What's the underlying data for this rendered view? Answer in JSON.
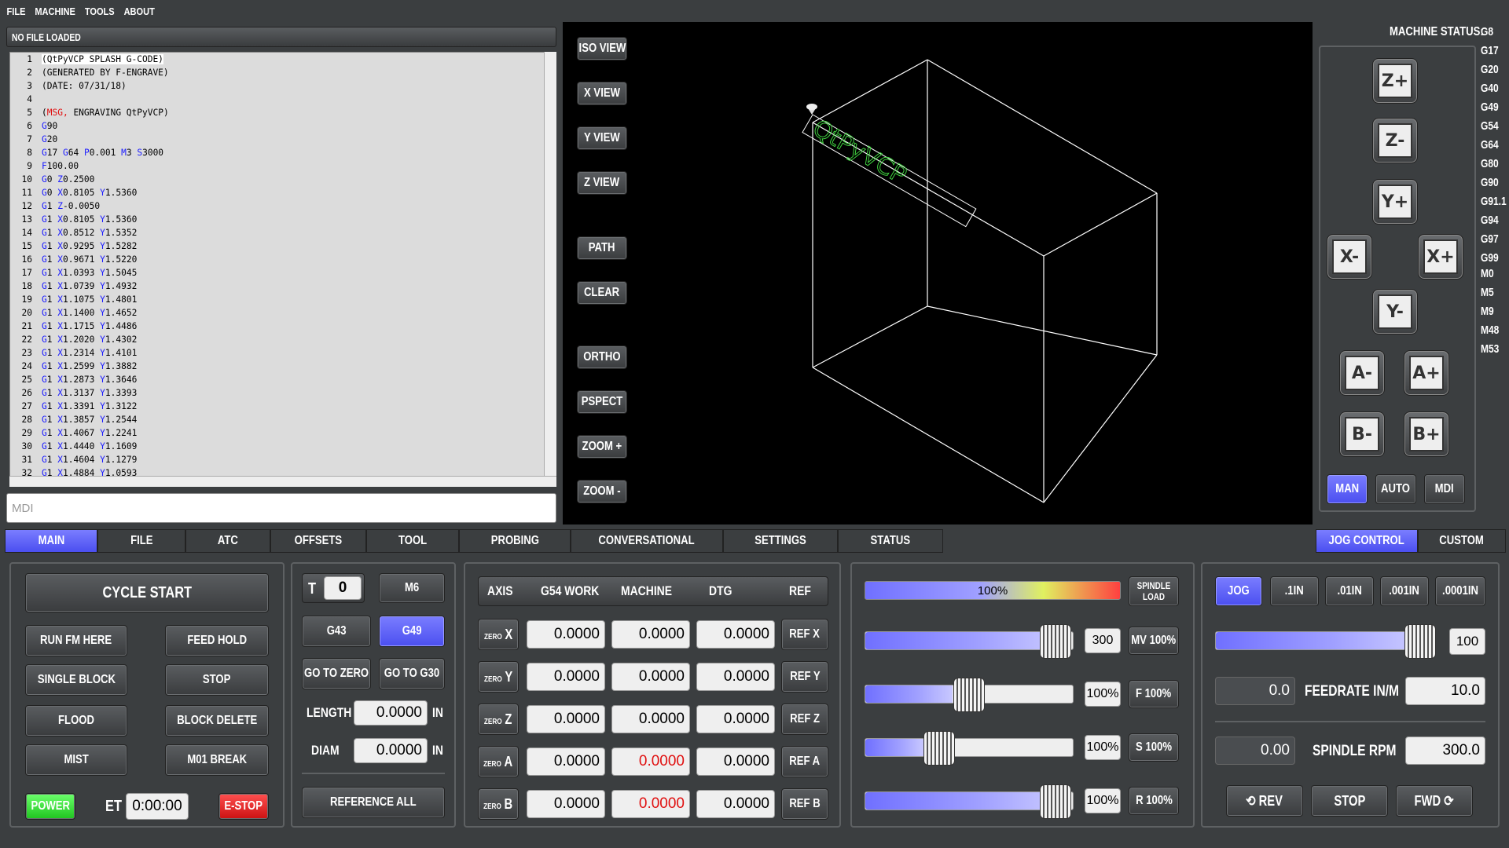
{
  "menu": [
    "FILE",
    "MACHINE",
    "TOOLS",
    "ABOUT"
  ],
  "file_status": "NO FILE LOADED",
  "gcode_lines": [
    [
      "1",
      "(QtPyVCP SPLASH G-CODE)"
    ],
    [
      "2",
      "(GENERATED BY F-ENGRAVE)"
    ],
    [
      "3",
      "(DATE: 07/31/18)"
    ],
    [
      "4",
      ""
    ],
    [
      "5",
      "(MSG, ENGRAVING QtPyVCP)"
    ],
    [
      "6",
      "G90"
    ],
    [
      "7",
      "G20"
    ],
    [
      "8",
      "G17 G64 P0.001 M3 S3000"
    ],
    [
      "9",
      "F100.00"
    ],
    [
      "10",
      "G0 Z0.2500"
    ],
    [
      "11",
      "G0 X0.8105 Y1.5360"
    ],
    [
      "12",
      "G1 Z-0.0050"
    ],
    [
      "13",
      "G1 X0.8105 Y1.5360"
    ],
    [
      "14",
      "G1 X0.8512 Y1.5352"
    ],
    [
      "15",
      "G1 X0.9295 Y1.5282"
    ],
    [
      "16",
      "G1 X0.9671 Y1.5220"
    ],
    [
      "17",
      "G1 X1.0393 Y1.5045"
    ],
    [
      "18",
      "G1 X1.0739 Y1.4932"
    ],
    [
      "19",
      "G1 X1.1075 Y1.4801"
    ],
    [
      "20",
      "G1 X1.1400 Y1.4652"
    ],
    [
      "21",
      "G1 X1.1715 Y1.4486"
    ],
    [
      "22",
      "G1 X1.2020 Y1.4302"
    ],
    [
      "23",
      "G1 X1.2314 Y1.4101"
    ],
    [
      "24",
      "G1 X1.2599 Y1.3882"
    ],
    [
      "25",
      "G1 X1.2873 Y1.3646"
    ],
    [
      "26",
      "G1 X1.3137 Y1.3393"
    ],
    [
      "27",
      "G1 X1.3391 Y1.3122"
    ],
    [
      "28",
      "G1 X1.3857 Y1.2544"
    ],
    [
      "29",
      "G1 X1.4067 Y1.2241"
    ],
    [
      "30",
      "G1 X1.4440 Y1.1609"
    ],
    [
      "31",
      "G1 X1.4604 Y1.1279"
    ],
    [
      "32",
      "G1 X1.4884 Y1.0593"
    ]
  ],
  "mdi_placeholder": "MDI",
  "view_buttons": [
    "ISO VIEW",
    "X VIEW",
    "Y VIEW",
    "Z VIEW",
    "PATH",
    "CLEAR",
    "ORTHO",
    "PSPECT",
    "ZOOM +",
    "ZOOM -"
  ],
  "machine_status_label": "MACHINE STATUS:",
  "gcodes": [
    "G8",
    "G17",
    "G20",
    "G40",
    "G49",
    "G54",
    "G64",
    "G80",
    "G90",
    "G91.1",
    "G94",
    "G97",
    "G99",
    "M0",
    "M5",
    "M9",
    "M48",
    "M53"
  ],
  "jog": {
    "zp": "Z+",
    "zm": "Z-",
    "yp": "Y+",
    "xm": "X-",
    "xp": "X+",
    "ym": "Y-",
    "am": "A-",
    "ap": "A+",
    "bm": "B-",
    "bp": "B+"
  },
  "modes": [
    "MAN",
    "AUTO",
    "MDI"
  ],
  "tabs": [
    "MAIN",
    "FILE",
    "ATC",
    "OFFSETS",
    "TOOL",
    "PROBING",
    "CONVERSATIONAL",
    "SETTINGS",
    "STATUS"
  ],
  "right_tabs": [
    "JOG CONTROL",
    "CUSTOM"
  ],
  "main": {
    "cycle_start": "CYCLE START",
    "run_from_here": "RUN FM HERE",
    "feed_hold": "FEED HOLD",
    "single_block": "SINGLE BLOCK",
    "stop": "STOP",
    "flood": "FLOOD",
    "block_delete": "BLOCK DELETE",
    "mist": "MIST",
    "m01_break": "M01 BREAK",
    "power": "POWER",
    "et_label": "ET",
    "et_value": "0:00:00",
    "estop": "E-STOP"
  },
  "tool": {
    "t_label": "T",
    "t_value": "0",
    "m6": "M6",
    "g43": "G43",
    "g49": "G49",
    "go_to_zero": "GO TO ZERO",
    "go_to_g30": "GO TO G30",
    "length_label": "LENGTH",
    "length_value": "0.0000",
    "length_unit": "IN",
    "diam_label": "DIAM",
    "diam_value": "0.0000",
    "diam_unit": "IN",
    "reference_all": "REFERENCE ALL"
  },
  "dro": {
    "headers": [
      "AXIS",
      "G54 WORK",
      "MACHINE",
      "DTG",
      "REF"
    ],
    "zero_label": "ZERO",
    "rows": [
      {
        "axis": "X",
        "work": "0.0000",
        "machine": "0.0000",
        "dtg": "0.0000",
        "ref": "REF X",
        "red": false
      },
      {
        "axis": "Y",
        "work": "0.0000",
        "machine": "0.0000",
        "dtg": "0.0000",
        "ref": "REF Y",
        "red": false
      },
      {
        "axis": "Z",
        "work": "0.0000",
        "machine": "0.0000",
        "dtg": "0.0000",
        "ref": "REF Z",
        "red": false
      },
      {
        "axis": "A",
        "work": "0.0000",
        "machine": "0.0000",
        "dtg": "0.0000",
        "ref": "REF A",
        "red": true
      },
      {
        "axis": "B",
        "work": "0.0000",
        "machine": "0.0000",
        "dtg": "0.0000",
        "ref": "REF B",
        "red": true
      }
    ]
  },
  "overrides": {
    "spindle_load": "100%",
    "spindle_load_label": "SPINDLE LOAD",
    "max_vel_value": "300",
    "mv_btn": "MV 100%",
    "feed_value": "100%",
    "f_btn": "F 100%",
    "spindle_value": "100%",
    "s_btn": "S 100%",
    "rapid_value": "100%",
    "r_btn": "R 100%",
    "levels": {
      "max_vel": 0.92,
      "feed": 0.5,
      "spindle": 0.3,
      "rapid": 0.92
    }
  },
  "jog_panel": {
    "increments": [
      "JOG",
      ".1IN",
      ".01IN",
      ".001IN",
      ".0001IN"
    ],
    "jog_speed": "100",
    "jog_level": 0.92,
    "feedrate_actual": "0.0",
    "feedrate_label": "FEEDRATE IN/M",
    "feedrate_set": "10.0",
    "rpm_actual": "0.00",
    "rpm_label": "SPINDLE RPM",
    "rpm_set": "300.0",
    "rev": "⟲ REV",
    "stop": "STOP",
    "fwd": "FWD ⟳"
  },
  "viewport_text": "QtPyVCP"
}
